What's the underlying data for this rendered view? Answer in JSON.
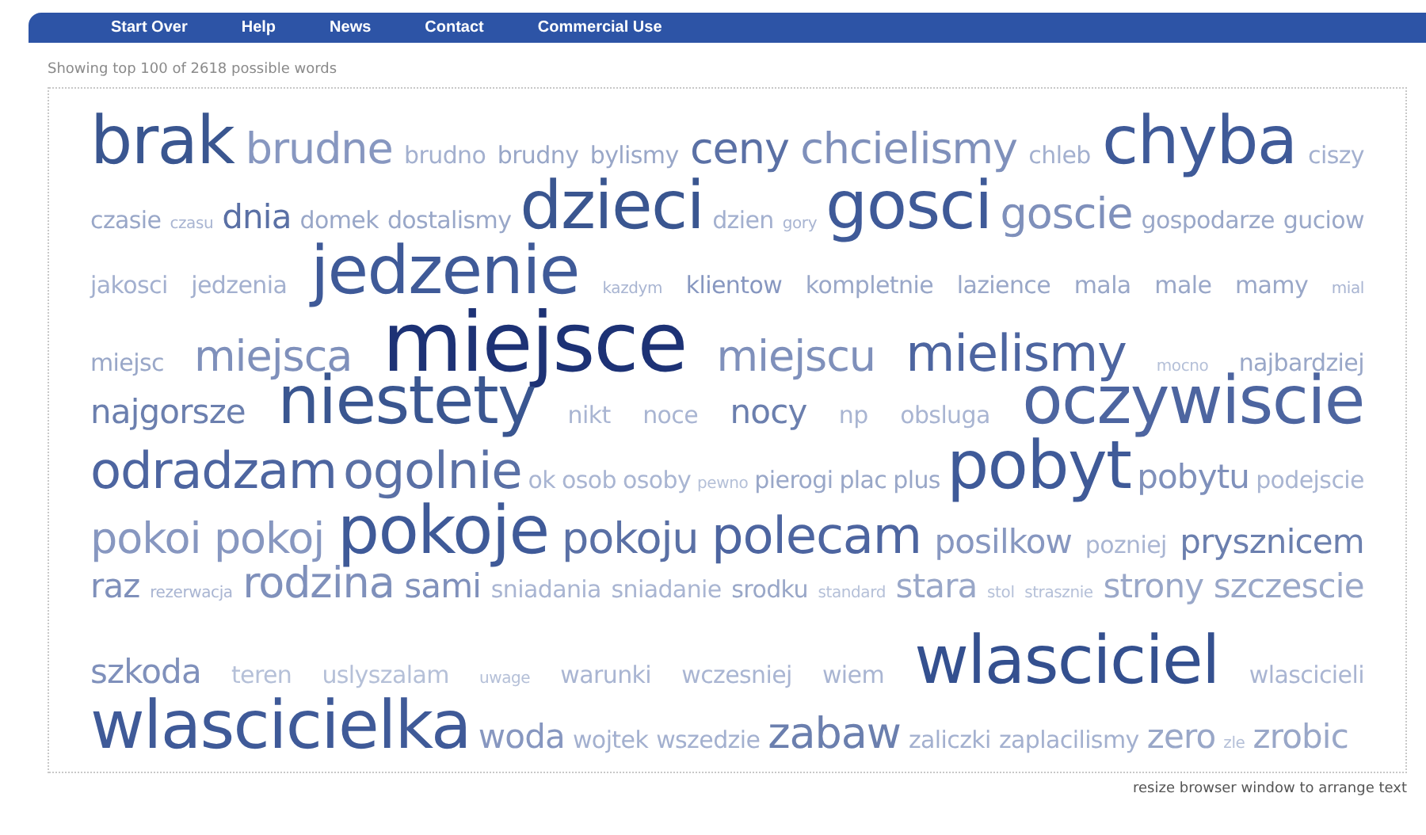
{
  "nav": [
    {
      "label": "Start Over"
    },
    {
      "label": "Help"
    },
    {
      "label": "News"
    },
    {
      "label": "Contact"
    },
    {
      "label": "Commercial Use"
    }
  ],
  "summary": "Showing top 100 of 2618 possible words",
  "cloud": {
    "lines": [
      [
        {
          "text": "brak",
          "kind": "huge",
          "color": "#3a5690"
        },
        {
          "text": "brudne",
          "kind": "large",
          "color": "#8797c0"
        },
        {
          "text": "brudno",
          "kind": "small",
          "color": "#a3b0cf"
        },
        {
          "text": "brudny",
          "kind": "small",
          "color": "#99a7c8"
        },
        {
          "text": "bylismy",
          "kind": "small",
          "color": "#99a7c8"
        },
        {
          "text": "ceny",
          "kind": "large",
          "color": "#5a70a5"
        },
        {
          "text": "chcielismy",
          "kind": "large",
          "color": "#7f90bb"
        },
        {
          "text": "chleb",
          "kind": "small",
          "color": "#a3b0cf"
        },
        {
          "text": "chyba",
          "kind": "huge",
          "color": "#3f5a98"
        },
        {
          "text": "ciszy",
          "kind": "small",
          "color": "#a3b0cf"
        }
      ],
      [
        {
          "text": "czasie",
          "kind": "small",
          "color": "#99a7c8"
        },
        {
          "text": "czasu",
          "kind": "tiny",
          "color": "#a9b5d2"
        },
        {
          "text": "dnia",
          "kind": "medium",
          "color": "#5a70a5"
        },
        {
          "text": "domek",
          "kind": "small",
          "color": "#99a7c8"
        },
        {
          "text": "dostalismy",
          "kind": "small",
          "color": "#99a7c8"
        },
        {
          "text": "dzieci",
          "kind": "huge",
          "color": "#3a5690"
        },
        {
          "text": "dzien",
          "kind": "small",
          "color": "#a3b0cf"
        },
        {
          "text": "gory",
          "kind": "tiny",
          "color": "#a9b5d2"
        },
        {
          "text": "gosci",
          "kind": "huge",
          "color": "#3f5a98"
        },
        {
          "text": "goscie",
          "kind": "large",
          "color": "#7f90bb"
        },
        {
          "text": "gospodarze",
          "kind": "small",
          "color": "#99a7c8"
        },
        {
          "text": "guciow",
          "kind": "small",
          "color": "#99a7c8"
        }
      ],
      [
        {
          "text": "jakosci",
          "kind": "small",
          "color": "#a3b0cf"
        },
        {
          "text": "jedzenia",
          "kind": "small",
          "color": "#a3b0cf"
        },
        {
          "text": "jedzenie",
          "kind": "huge",
          "color": "#3f5a98"
        },
        {
          "text": "kazdym",
          "kind": "tiny",
          "color": "#a9b5d2"
        },
        {
          "text": "klientow",
          "kind": "small",
          "color": "#8797c0"
        },
        {
          "text": "kompletnie",
          "kind": "small",
          "color": "#99a7c8"
        },
        {
          "text": "lazience",
          "kind": "small",
          "color": "#99a7c8"
        },
        {
          "text": "mala",
          "kind": "small",
          "color": "#99a7c8"
        },
        {
          "text": "male",
          "kind": "small",
          "color": "#99a7c8"
        },
        {
          "text": "mamy",
          "kind": "small",
          "color": "#99a7c8"
        },
        {
          "text": "mial",
          "kind": "tiny",
          "color": "#a9b5d2"
        }
      ],
      [
        {
          "text": "miejsc",
          "kind": "small",
          "color": "#99a7c8"
        },
        {
          "text": "miejsca",
          "kind": "large",
          "color": "#7f90bb"
        },
        {
          "text": "miejsce",
          "kind": "giant",
          "color": "#1d3275"
        },
        {
          "text": "miejscu",
          "kind": "large",
          "color": "#7f90bb"
        },
        {
          "text": "mielismy",
          "kind": "xlarge",
          "color": "#4d65a0"
        },
        {
          "text": "mocno",
          "kind": "tiny",
          "color": "#b5c0d8"
        },
        {
          "text": "najbardziej",
          "kind": "small",
          "color": "#99a7c8"
        }
      ],
      [
        {
          "text": "najgorsze",
          "kind": "medium",
          "color": "#6b7fae"
        },
        {
          "text": "niestety",
          "kind": "huge",
          "color": "#3a5690"
        },
        {
          "text": "nikt",
          "kind": "small",
          "color": "#a9b5d2"
        },
        {
          "text": "noce",
          "kind": "small",
          "color": "#a9b5d2"
        },
        {
          "text": "nocy",
          "kind": "medium",
          "color": "#6b7fae"
        },
        {
          "text": "np",
          "kind": "small",
          "color": "#a9b5d2"
        },
        {
          "text": "obsluga",
          "kind": "small",
          "color": "#a9b5d2"
        },
        {
          "text": "oczywiscie",
          "kind": "huge",
          "color": "#4d65a0"
        }
      ],
      [
        {
          "text": "odradzam",
          "kind": "xlarge",
          "color": "#4d65a0"
        },
        {
          "text": "ogolnie",
          "kind": "xlarge",
          "color": "#5a70a5"
        },
        {
          "text": "ok",
          "kind": "small",
          "color": "#a9b5d2"
        },
        {
          "text": "osob",
          "kind": "small",
          "color": "#a9b5d2"
        },
        {
          "text": "osoby",
          "kind": "small",
          "color": "#a9b5d2"
        },
        {
          "text": "pewno",
          "kind": "tiny",
          "color": "#b5c0d8"
        },
        {
          "text": "pierogi",
          "kind": "small",
          "color": "#99a7c8"
        },
        {
          "text": "plac",
          "kind": "small",
          "color": "#99a7c8"
        },
        {
          "text": "plus",
          "kind": "small",
          "color": "#99a7c8"
        },
        {
          "text": "pobyt",
          "kind": "huge",
          "color": "#3f5a98"
        },
        {
          "text": "pobytu",
          "kind": "medium",
          "color": "#7f90bb"
        },
        {
          "text": "podejscie",
          "kind": "small",
          "color": "#a9b5d2"
        }
      ],
      [
        {
          "text": "pokoi",
          "kind": "large",
          "color": "#8797c0"
        },
        {
          "text": "pokoj",
          "kind": "large",
          "color": "#8797c0"
        },
        {
          "text": "pokoje",
          "kind": "huge",
          "color": "#3f5a98"
        },
        {
          "text": "pokoju",
          "kind": "large",
          "color": "#5a70a5"
        },
        {
          "text": "polecam",
          "kind": "xlarge",
          "color": "#4d65a0"
        },
        {
          "text": "posilkow",
          "kind": "medium",
          "color": "#8797c0"
        },
        {
          "text": "pozniej",
          "kind": "small",
          "color": "#a9b5d2"
        },
        {
          "text": "prysznicem",
          "kind": "medium",
          "color": "#6b7fae"
        }
      ],
      [
        {
          "text": "raz",
          "kind": "medium",
          "color": "#7f90bb"
        },
        {
          "text": "rezerwacja",
          "kind": "tiny",
          "color": "#a9b5d2"
        },
        {
          "text": "rodzina",
          "kind": "large",
          "color": "#7f90bb"
        },
        {
          "text": "sami",
          "kind": "medium",
          "color": "#7f90bb"
        },
        {
          "text": "sniadania",
          "kind": "small",
          "color": "#a9b5d2"
        },
        {
          "text": "sniadanie",
          "kind": "small",
          "color": "#a9b5d2"
        },
        {
          "text": "srodku",
          "kind": "small",
          "color": "#99a7c8"
        },
        {
          "text": "standard",
          "kind": "tiny",
          "color": "#b5c0d8"
        },
        {
          "text": "stara",
          "kind": "medium",
          "color": "#99a7c8"
        },
        {
          "text": "stol",
          "kind": "tiny",
          "color": "#b5c0d8"
        },
        {
          "text": "strasznie",
          "kind": "tiny",
          "color": "#b5c0d8"
        },
        {
          "text": "strony",
          "kind": "medium",
          "color": "#99a7c8"
        },
        {
          "text": "szczescie",
          "kind": "medium",
          "color": "#99a7c8"
        }
      ],
      [
        {
          "text": "szkoda",
          "kind": "medium",
          "color": "#7f90bb"
        },
        {
          "text": "teren",
          "kind": "small",
          "color": "#b5c0d8"
        },
        {
          "text": "uslyszalam",
          "kind": "small",
          "color": "#b5c0d8"
        },
        {
          "text": "uwage",
          "kind": "tiny",
          "color": "#b5c0d8"
        },
        {
          "text": "warunki",
          "kind": "small",
          "color": "#a9b5d2"
        },
        {
          "text": "wczesniej",
          "kind": "small",
          "color": "#a9b5d2"
        },
        {
          "text": "wiem",
          "kind": "small",
          "color": "#a9b5d2"
        },
        {
          "text": "wlasciciel",
          "kind": "huge",
          "color": "#34508f"
        },
        {
          "text": "wlascicieli",
          "kind": "small",
          "color": "#a9b5d2"
        }
      ],
      [
        {
          "text": "wlascicielka",
          "kind": "huge",
          "color": "#3f5a98"
        },
        {
          "text": "woda",
          "kind": "medium",
          "color": "#8797c0"
        },
        {
          "text": "wojtek",
          "kind": "small",
          "color": "#a3b0cf"
        },
        {
          "text": "wszedzie",
          "kind": "small",
          "color": "#a3b0cf"
        },
        {
          "text": "zabaw",
          "kind": "large",
          "color": "#6b7fae"
        },
        {
          "text": "zaliczki",
          "kind": "small",
          "color": "#a3b0cf"
        },
        {
          "text": "zaplacilismy",
          "kind": "small",
          "color": "#a3b0cf"
        },
        {
          "text": "zero",
          "kind": "medium",
          "color": "#99a7c8"
        },
        {
          "text": "zle",
          "kind": "tiny",
          "color": "#b5c0d8"
        },
        {
          "text": "zrobic",
          "kind": "medium",
          "color": "#99a7c8"
        }
      ]
    ]
  },
  "hint": "resize browser window to arrange text"
}
